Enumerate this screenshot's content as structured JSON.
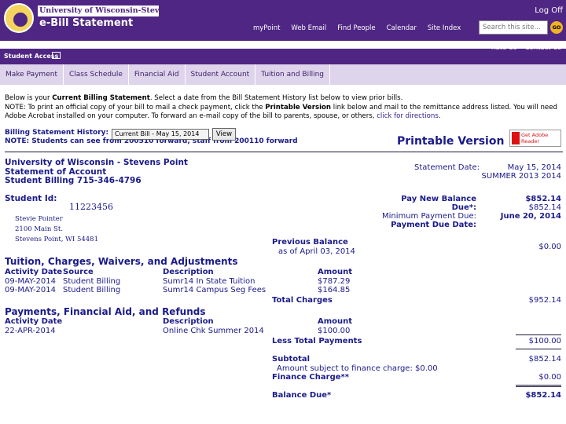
{
  "header": {
    "university": "University of Wisconsin-Stevens Point",
    "app_title": "e-Bill Statement",
    "logoff": "Log Off",
    "nav": [
      "myPoint",
      "Web Email",
      "Find People",
      "Calendar",
      "Site Index"
    ],
    "search_placeholder": "Search this site...",
    "go": "GO"
  },
  "student_access": {
    "label": "Student Access",
    "links": [
      "Rate Us",
      "Contact Us"
    ]
  },
  "tabs": [
    "Make Payment",
    "Class Schedule",
    "Financial Aid",
    "Student Account",
    "Tuition and Billing"
  ],
  "intro": {
    "line1_pre": "Below is your ",
    "line1_bold": "Current Billing Statement",
    "line1_post": ". Select a date from the Bill Statement History list below to view prior bills.",
    "line2_pre": "NOTE: To print an official copy of your bill to mail a check payment, click the ",
    "line2_bold": "Printable Version",
    "line2_post": " link below and mail to the remittance address listed. You will need",
    "line3_pre": "Adobe Acrobat installed on your computer. To forward an e-mail copy of the bill to parents, spouse, or others, ",
    "line3_link": "click for directions",
    "line3_post": "."
  },
  "history": {
    "label": "Billing Statement History:",
    "note": "NOTE: Students can see from 200510 forward, staff from 200110 forward",
    "selected": "Current Bill - May 15, 2014",
    "view_button": "View"
  },
  "printable_version": "Printable Version",
  "acrobat_badge": "Get Adobe Reader",
  "statement": {
    "org_line1": "University of Wisconsin - Stevens Point",
    "org_line2": "Statement of Account",
    "org_line3": "Student Billing 715-346-4796",
    "date_label": "Statement Date:",
    "date_value": "May 15, 2014",
    "term": "SUMMER 2013 2014",
    "student_id_label": "Student Id:",
    "student_id_value": "11223456",
    "address": [
      "Stevie Pointer",
      "2100 Main St.",
      "Stevens Point, WI 54481"
    ],
    "pay_new_label": "Pay New Balance Due*:",
    "pay_new_value": "$852.14",
    "min_payment_label": "Minimum Payment Due:",
    "min_payment_value": "$852.14",
    "due_date_label": "Payment Due Date:",
    "due_date_value": "June 20, 2014"
  },
  "previous_balance": {
    "label": "Previous Balance",
    "as_of": "as of April 03, 2014",
    "amount": "$0.00"
  },
  "charges": {
    "title": "Tuition, Charges, Waivers, and Adjustments",
    "headers": [
      "Activity Date",
      "Source",
      "Description",
      "Amount"
    ],
    "rows": [
      [
        "09-MAY-2014",
        "Student Billing",
        "Sumr14 In State Tuition",
        "$787.29"
      ],
      [
        "09-MAY-2014",
        "Student Billing",
        "Sumr14 Campus Seg Fees",
        "$164.85"
      ]
    ],
    "total_label": "Total Charges",
    "total_value": "$952.14"
  },
  "payments": {
    "title": "Payments, Financial Aid, and Refunds",
    "headers": [
      "Activity Date",
      "Description",
      "Amount"
    ],
    "rows": [
      [
        "22-APR-2014",
        "Online Chk Summer 2014",
        "$100.00"
      ]
    ],
    "total_label": "Less Total Payments",
    "total_value": "$100.00"
  },
  "summary": {
    "subtotal_label": "Subtotal",
    "subtotal_value": "$852.14",
    "finance_subject": "Amount subject to finance charge: $0.00",
    "finance_label": "Finance Charge**",
    "finance_value": "$0.00",
    "balance_label": "Balance Due*",
    "balance_value": "$852.14"
  }
}
